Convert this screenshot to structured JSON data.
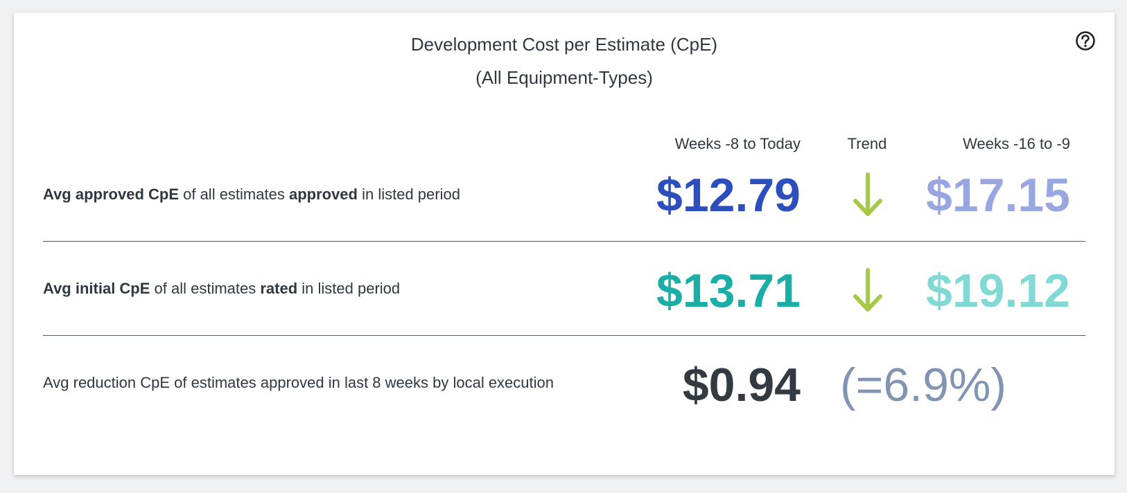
{
  "card": {
    "title_line1": "Development Cost per Estimate (CpE)",
    "title_line2": "(All Equipment-Types)",
    "help_icon": "question-circle-icon"
  },
  "columns": {
    "current": "Weeks -8 to Today",
    "trend": "Trend",
    "previous": "Weeks -16 to -9"
  },
  "rows": [
    {
      "label_prefix": "Avg approved CpE",
      "label_mid": " of all estimates ",
      "label_bold": "approved",
      "label_suffix": " in listed period",
      "current": "$12.79",
      "trend_icon": "arrow-down-icon",
      "previous": "$17.15",
      "current_color": "#2d4fbd",
      "previous_color": "#98a7e0"
    },
    {
      "label_prefix": "Avg initial CpE",
      "label_mid": " of all estimates ",
      "label_bold": "rated",
      "label_suffix": " in listed period",
      "current": "$13.71",
      "trend_icon": "arrow-down-icon",
      "previous": "$19.12",
      "current_color": "#1aaea6",
      "previous_color": "#82d8d3"
    }
  ],
  "reduction": {
    "label": "Avg reduction CpE of estimates approved in last 8 weeks by local execution",
    "amount": "$0.94",
    "percent": "(=6.9%)",
    "amount_color": "#343a41",
    "percent_color": "#8195b2"
  },
  "colors": {
    "trend_arrow": "#a7c94a",
    "text": "#2e3742"
  }
}
